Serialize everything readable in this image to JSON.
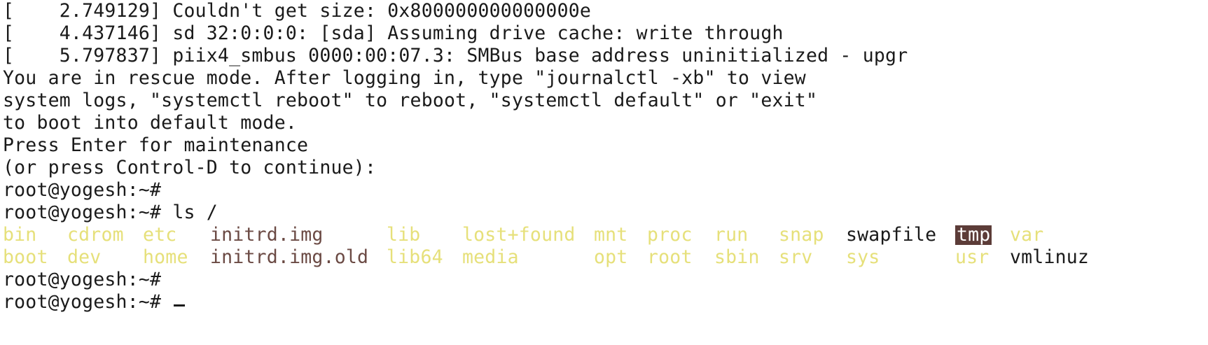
{
  "terminal": {
    "lines": [
      "[    2.749129] Couldn't get size: 0x800000000000000e",
      "[    4.437146] sd 32:0:0:0: [sda] Assuming drive cache: write through",
      "[    5.797837] piix4_smbus 0000:00:07.3: SMBus base address uninitialized - upgr",
      "You are in rescue mode. After logging in, type \"journalctl -xb\" to view",
      "system logs, \"systemctl reboot\" to reboot, \"systemctl default\" or \"exit\"",
      "to boot into default mode.",
      "Press Enter for maintenance",
      "(or press Control-D to continue):",
      "root@yogesh:~#",
      "root@yogesh:~# ls /"
    ],
    "ls_rows": [
      [
        {
          "name": "bin",
          "kind": "dir"
        },
        {
          "name": "cdrom",
          "kind": "dir"
        },
        {
          "name": "etc",
          "kind": "dir"
        },
        {
          "name": "initrd.img",
          "kind": "link"
        },
        {
          "name": "lib",
          "kind": "dir"
        },
        {
          "name": "lost+found",
          "kind": "dir"
        },
        {
          "name": "mnt",
          "kind": "dir"
        },
        {
          "name": "proc",
          "kind": "dir"
        },
        {
          "name": "run",
          "kind": "dir"
        },
        {
          "name": "snap",
          "kind": "dir"
        },
        {
          "name": "swapfile",
          "kind": "file"
        },
        {
          "name": "tmp",
          "kind": "sticky"
        },
        {
          "name": "var",
          "kind": "dir"
        }
      ],
      [
        {
          "name": "boot",
          "kind": "dir"
        },
        {
          "name": "dev",
          "kind": "dir"
        },
        {
          "name": "home",
          "kind": "dir"
        },
        {
          "name": "initrd.img.old",
          "kind": "link"
        },
        {
          "name": "lib64",
          "kind": "dir"
        },
        {
          "name": "media",
          "kind": "dir"
        },
        {
          "name": "opt",
          "kind": "dir"
        },
        {
          "name": "root",
          "kind": "dir"
        },
        {
          "name": "sbin",
          "kind": "dir"
        },
        {
          "name": "srv",
          "kind": "dir"
        },
        {
          "name": "sys",
          "kind": "dir"
        },
        {
          "name": "usr",
          "kind": "dir"
        },
        {
          "name": "vmlinuz",
          "kind": "file"
        }
      ]
    ],
    "after_lines": [
      "root@yogesh:~#",
      "root@yogesh:~# "
    ],
    "colors": {
      "background": "#ffffff",
      "text": "#1a1a1a",
      "dir": "#e6e07a",
      "link": "#6b4a44",
      "sticky_bg": "#5c3c38",
      "sticky_fg": "#ffffff"
    }
  }
}
